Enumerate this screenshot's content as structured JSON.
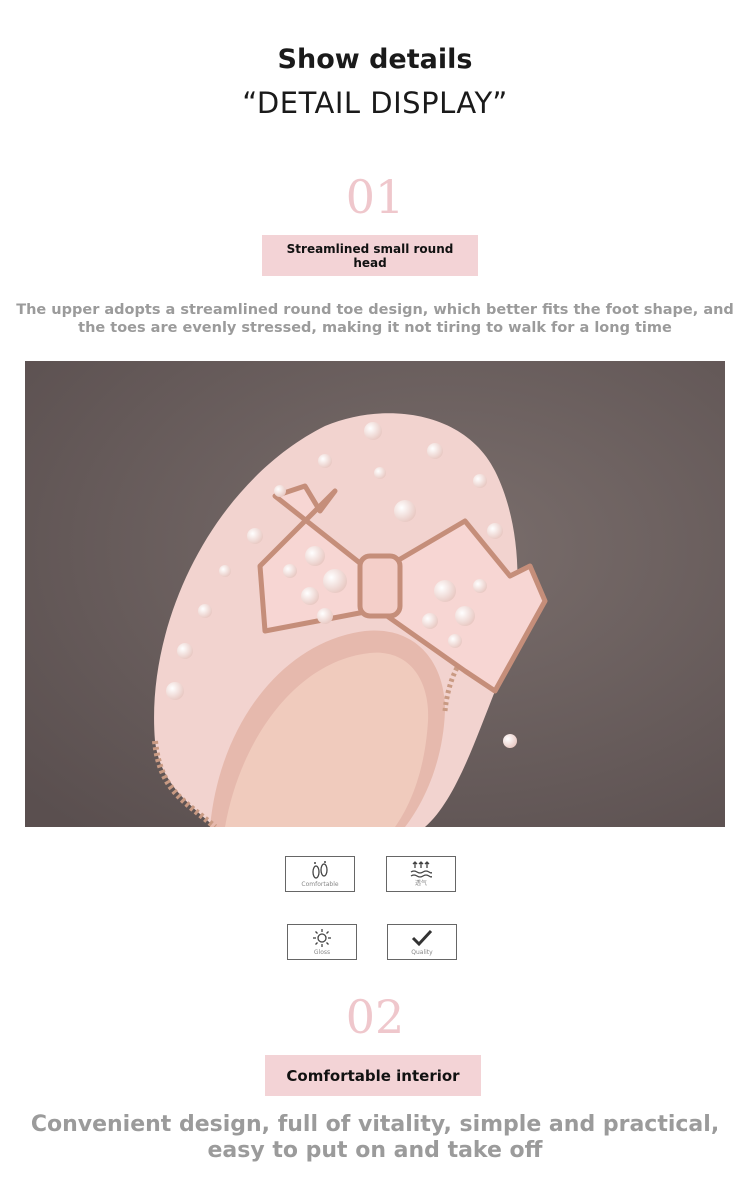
{
  "header": {
    "title": "Show details",
    "subtitle": "“DETAIL DISPLAY”"
  },
  "section1": {
    "number": "01",
    "label": "Streamlined small round head",
    "description_line1": "The upper adopts a streamlined round toe design, which better fits the foot shape, and",
    "description_line2": "the toes are evenly stressed, making it not tiring to walk for a long time"
  },
  "photo": {
    "subject": "pink pearl bow shoe toe close-up",
    "background_color": "#6b5f5e",
    "shoe_color": "#f2d0cc"
  },
  "features": [
    {
      "icon": "footprint-icon",
      "caption": "Comfortable"
    },
    {
      "icon": "breathable-icon",
      "caption": "透气"
    },
    {
      "icon": "sun-icon",
      "caption": "Gloss"
    },
    {
      "icon": "checkmark-icon",
      "caption": "Quality"
    }
  ],
  "section2": {
    "number": "02",
    "label": "Comfortable interior",
    "description_line1": "Convenient design, full of vitality, simple and practical,",
    "description_line2": "easy to put on and take off"
  },
  "colors": {
    "accent_pink": "#f3d3d6",
    "number_pink": "#efc7cc",
    "description_gray": "#9b9b9b"
  }
}
